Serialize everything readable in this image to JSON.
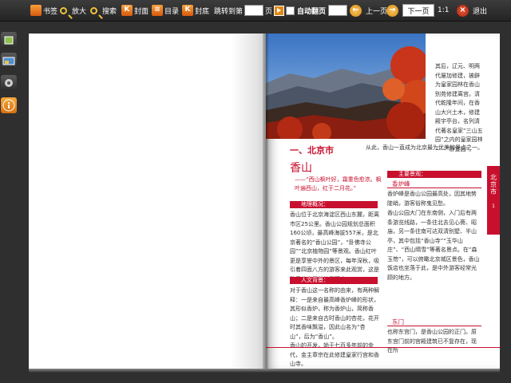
{
  "toolbar": {
    "bookmark": "书签",
    "zoom": "放大",
    "search": "搜索",
    "cover": "封面",
    "toc": "目录",
    "back_cover": "封底",
    "jump_prefix": "跳转到第",
    "jump_suffix": "页",
    "auto_flip": "自动翻页",
    "seconds": "秒",
    "prev": "上一页",
    "next": "下一页",
    "ratio": "1:1",
    "exit": "退出"
  },
  "book": {
    "chapter": "一、北京市",
    "city_title": "香山",
    "poem": "——“西山枫叶好，霜重色愈浓。枫叶遍西山，红于二月花。”",
    "column_top": "其后，辽元、明两代屡加修建，被辟为皇家园林在香山别苑修建离宫。清代乾隆年间，在香山大兴土木，修建殿宇亭台，名列清代著名皇家“三山五园”之内的皇家园林——“静宜园”。",
    "wrap_line": "从此，香山一直成为北京最为优美的景点之一。",
    "section1": "地理概况：",
    "para1": "香山位于北京海淀区西山东麓，距离市区25公里。香山公园规划总面积160公顷，最高峰海拔557米，是北京著名的“香山公园”，“卧佛寺公园”“北京植物园”等景观。香山红叶更是享誉中外的景区，每年深秋，吸引着四面八方的游客来此观赏，这是秋季北京最美的景观之一。",
    "section2": "人文背景：",
    "para2": "对于香山这一名称的由来，有两种解释：一是来自最高峰香炉峰的形状，其形似香炉，称为香炉山，简称香山；二是来自古时香山的杏花，花开时其香味飘溢，因此山名为“杏山”，后为“香山”。",
    "para3": "香山的开发，始于七百多年前的金代，金主章宗在此修建皇家行宫和香山寺。",
    "section3": "主要景观：",
    "spot1": "香炉峰",
    "para4": "香炉峰是香山公园最高处，因其地势陡峭，游客俗称鬼见愁。",
    "para5": "香山公园大门在东南侧，入门后有两条游览线路，一条往北去见心斋、昭庙，另一条往南可达双清别墅、半山亭，其中包括“香山寺”“玉华山庄”、“西山晴雪”等著名景点。在“森玉笏”，可以俯瞰北京城区景色，香山饭店也坐落于此，是中外游客经常光顾的地方。",
    "spot2": "东门",
    "para6": "也称东宫门，是香山公园的正门。原东宫门前的宫殿建筑已不复存在，现在所",
    "side_tab": "北京市",
    "page_no": "1"
  },
  "colors": {
    "accent": "#c8102e",
    "toolbar_bg": "#2b2b2b",
    "orange_icon": "#f28a1e"
  }
}
